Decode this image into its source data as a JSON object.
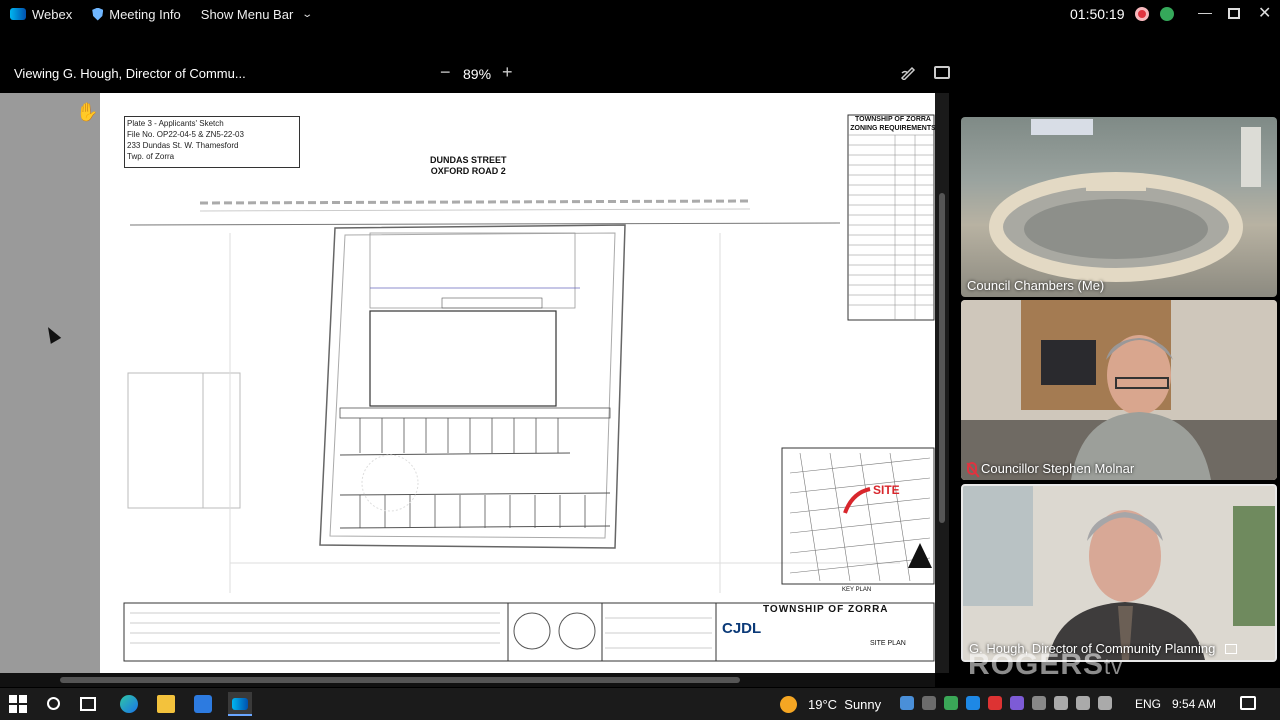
{
  "topbar": {
    "app_name": "Webex",
    "meeting_info": "Meeting Info",
    "show_menu_bar": "Show Menu Bar",
    "clock": "01:50:19"
  },
  "share": {
    "viewing": "Viewing G. Hough, Director of Commu...",
    "zoom": "89%",
    "zoom_minus": "−",
    "zoom_plus": "+"
  },
  "document": {
    "plate_lines": [
      "Plate 3 - Applicants' Sketch",
      "File No. OP22-04-5 & ZN5-22-03",
      "233 Dundas St. W. Thamesford",
      "Twp. of Zorra"
    ],
    "road_line1": "DUNDAS STREET",
    "road_line2": "OXFORD ROAD 2",
    "zoning_title": "TOWNSHIP OF ZORRA ZONING REQUIREMENTS",
    "site_label": "SITE",
    "key_plan": "KEY PLAN",
    "titleblock_name": "TOWNSHIP OF ZORRA",
    "firm": "CJDL",
    "sheet_title": "SITE PLAN"
  },
  "participants": [
    {
      "name": "Council Chambers (Me)",
      "muted": false
    },
    {
      "name": "Councillor Stephen Molnar",
      "muted": true
    },
    {
      "name": "G. Hough, Director of Community Planning",
      "muted": false
    }
  ],
  "watermark": {
    "brand": "ROGERS",
    "suffix": "tv"
  },
  "taskbar": {
    "temperature": "19°C",
    "weather": "Sunny",
    "language": "ENG",
    "time": "9:54 AM"
  },
  "colors": {
    "record": "#e0333f",
    "site_marker": "#d8262c",
    "weather_sun": "#f5a623"
  }
}
